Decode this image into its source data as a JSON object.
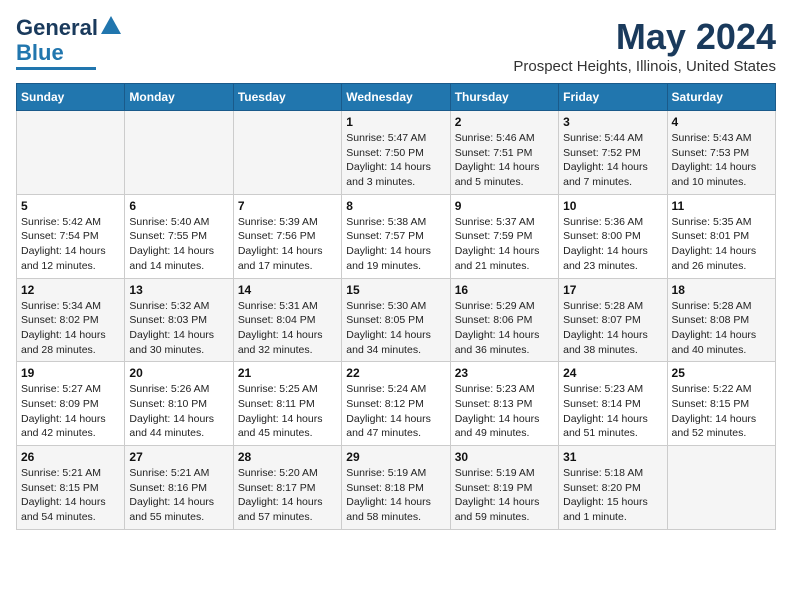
{
  "header": {
    "logo_line1": "General",
    "logo_line2": "Blue",
    "month": "May 2024",
    "location": "Prospect Heights, Illinois, United States"
  },
  "days_of_week": [
    "Sunday",
    "Monday",
    "Tuesday",
    "Wednesday",
    "Thursday",
    "Friday",
    "Saturday"
  ],
  "weeks": [
    [
      {
        "day": "",
        "info": ""
      },
      {
        "day": "",
        "info": ""
      },
      {
        "day": "",
        "info": ""
      },
      {
        "day": "1",
        "info": "Sunrise: 5:47 AM\nSunset: 7:50 PM\nDaylight: 14 hours\nand 3 minutes."
      },
      {
        "day": "2",
        "info": "Sunrise: 5:46 AM\nSunset: 7:51 PM\nDaylight: 14 hours\nand 5 minutes."
      },
      {
        "day": "3",
        "info": "Sunrise: 5:44 AM\nSunset: 7:52 PM\nDaylight: 14 hours\nand 7 minutes."
      },
      {
        "day": "4",
        "info": "Sunrise: 5:43 AM\nSunset: 7:53 PM\nDaylight: 14 hours\nand 10 minutes."
      }
    ],
    [
      {
        "day": "5",
        "info": "Sunrise: 5:42 AM\nSunset: 7:54 PM\nDaylight: 14 hours\nand 12 minutes."
      },
      {
        "day": "6",
        "info": "Sunrise: 5:40 AM\nSunset: 7:55 PM\nDaylight: 14 hours\nand 14 minutes."
      },
      {
        "day": "7",
        "info": "Sunrise: 5:39 AM\nSunset: 7:56 PM\nDaylight: 14 hours\nand 17 minutes."
      },
      {
        "day": "8",
        "info": "Sunrise: 5:38 AM\nSunset: 7:57 PM\nDaylight: 14 hours\nand 19 minutes."
      },
      {
        "day": "9",
        "info": "Sunrise: 5:37 AM\nSunset: 7:59 PM\nDaylight: 14 hours\nand 21 minutes."
      },
      {
        "day": "10",
        "info": "Sunrise: 5:36 AM\nSunset: 8:00 PM\nDaylight: 14 hours\nand 23 minutes."
      },
      {
        "day": "11",
        "info": "Sunrise: 5:35 AM\nSunset: 8:01 PM\nDaylight: 14 hours\nand 26 minutes."
      }
    ],
    [
      {
        "day": "12",
        "info": "Sunrise: 5:34 AM\nSunset: 8:02 PM\nDaylight: 14 hours\nand 28 minutes."
      },
      {
        "day": "13",
        "info": "Sunrise: 5:32 AM\nSunset: 8:03 PM\nDaylight: 14 hours\nand 30 minutes."
      },
      {
        "day": "14",
        "info": "Sunrise: 5:31 AM\nSunset: 8:04 PM\nDaylight: 14 hours\nand 32 minutes."
      },
      {
        "day": "15",
        "info": "Sunrise: 5:30 AM\nSunset: 8:05 PM\nDaylight: 14 hours\nand 34 minutes."
      },
      {
        "day": "16",
        "info": "Sunrise: 5:29 AM\nSunset: 8:06 PM\nDaylight: 14 hours\nand 36 minutes."
      },
      {
        "day": "17",
        "info": "Sunrise: 5:28 AM\nSunset: 8:07 PM\nDaylight: 14 hours\nand 38 minutes."
      },
      {
        "day": "18",
        "info": "Sunrise: 5:28 AM\nSunset: 8:08 PM\nDaylight: 14 hours\nand 40 minutes."
      }
    ],
    [
      {
        "day": "19",
        "info": "Sunrise: 5:27 AM\nSunset: 8:09 PM\nDaylight: 14 hours\nand 42 minutes."
      },
      {
        "day": "20",
        "info": "Sunrise: 5:26 AM\nSunset: 8:10 PM\nDaylight: 14 hours\nand 44 minutes."
      },
      {
        "day": "21",
        "info": "Sunrise: 5:25 AM\nSunset: 8:11 PM\nDaylight: 14 hours\nand 45 minutes."
      },
      {
        "day": "22",
        "info": "Sunrise: 5:24 AM\nSunset: 8:12 PM\nDaylight: 14 hours\nand 47 minutes."
      },
      {
        "day": "23",
        "info": "Sunrise: 5:23 AM\nSunset: 8:13 PM\nDaylight: 14 hours\nand 49 minutes."
      },
      {
        "day": "24",
        "info": "Sunrise: 5:23 AM\nSunset: 8:14 PM\nDaylight: 14 hours\nand 51 minutes."
      },
      {
        "day": "25",
        "info": "Sunrise: 5:22 AM\nSunset: 8:15 PM\nDaylight: 14 hours\nand 52 minutes."
      }
    ],
    [
      {
        "day": "26",
        "info": "Sunrise: 5:21 AM\nSunset: 8:15 PM\nDaylight: 14 hours\nand 54 minutes."
      },
      {
        "day": "27",
        "info": "Sunrise: 5:21 AM\nSunset: 8:16 PM\nDaylight: 14 hours\nand 55 minutes."
      },
      {
        "day": "28",
        "info": "Sunrise: 5:20 AM\nSunset: 8:17 PM\nDaylight: 14 hours\nand 57 minutes."
      },
      {
        "day": "29",
        "info": "Sunrise: 5:19 AM\nSunset: 8:18 PM\nDaylight: 14 hours\nand 58 minutes."
      },
      {
        "day": "30",
        "info": "Sunrise: 5:19 AM\nSunset: 8:19 PM\nDaylight: 14 hours\nand 59 minutes."
      },
      {
        "day": "31",
        "info": "Sunrise: 5:18 AM\nSunset: 8:20 PM\nDaylight: 15 hours\nand 1 minute."
      },
      {
        "day": "",
        "info": ""
      }
    ]
  ]
}
